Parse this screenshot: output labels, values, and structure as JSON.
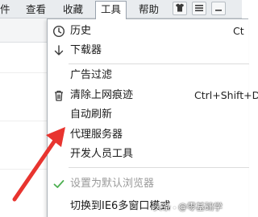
{
  "menubar": {
    "items": [
      {
        "label": "件"
      },
      {
        "label": "查看"
      },
      {
        "label": "收藏"
      },
      {
        "label": "工具"
      },
      {
        "label": "帮助"
      }
    ],
    "icons": [
      "shirt-icon",
      "menu-icon",
      "minimize-icon"
    ]
  },
  "tools_menu": {
    "items": [
      {
        "label": "历史",
        "shortcut": "Ct",
        "icon": "clock-icon"
      },
      {
        "label": "下载器",
        "shortcut": "",
        "icon": "download-icon"
      },
      {
        "label": "广告过滤",
        "shortcut": "",
        "icon": ""
      },
      {
        "label": "清除上网痕迹",
        "shortcut": "Ctrl+Shift+De",
        "icon": "trash-icon"
      },
      {
        "label": "自动刷新",
        "shortcut": "",
        "icon": ""
      },
      {
        "label": "代理服务器",
        "shortcut": "",
        "icon": ""
      },
      {
        "label": "开发人员工具",
        "shortcut": "",
        "icon": ""
      },
      {
        "label": "设置为默认浏览器",
        "shortcut": "",
        "icon": "check-icon",
        "disabled": true
      },
      {
        "label": "切换到IE6多窗口模式",
        "shortcut": "",
        "icon": ""
      }
    ]
  },
  "annotation": {
    "color": "#e8342f",
    "points_to": "代理服务器"
  },
  "watermark": {
    "source": "头条",
    "author": "@零基础学"
  },
  "colors": {
    "menubar_bg": "#e9ecef",
    "check_green": "#4caf50",
    "arrow_red": "#e8342f"
  }
}
